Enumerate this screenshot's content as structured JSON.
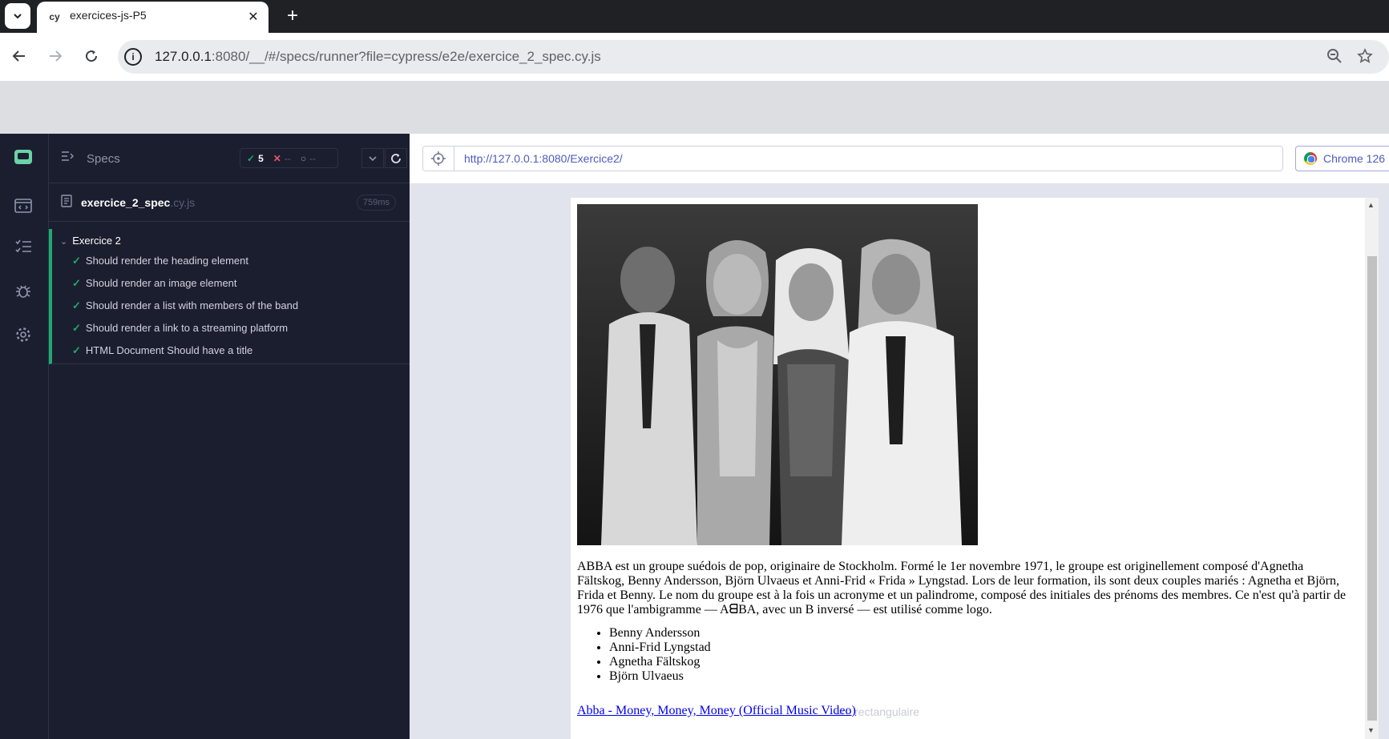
{
  "browser": {
    "tab_title": "exercices-js-P5",
    "tab_favicon_text": "cy",
    "new_tab_symbol": "+",
    "close_symbol": "✕",
    "url_host": "127.0.0.1",
    "url_rest": ":8080/__/#/specs/runner?file=cypress/e2e/exercice_2_spec.cy.js"
  },
  "runner": {
    "specs_label": "Specs",
    "stats": {
      "passed": "5",
      "failed": "--",
      "pending": "--"
    },
    "spec_file": {
      "name": "exercice_2_spec",
      "ext": ".cy.js",
      "duration": "759ms"
    },
    "suite": {
      "title": "Exercice 2",
      "tests": [
        {
          "title": "Should render the heading element"
        },
        {
          "title": "Should render an image element"
        },
        {
          "title": "Should render a list with members of the band"
        },
        {
          "title": "Should render a link to a streaming platform"
        },
        {
          "title": "HTML Document Should have a title"
        }
      ]
    }
  },
  "aut": {
    "url": "http://127.0.0.1:8080/Exercice2/",
    "browser_label": "Chrome 126",
    "paragraph": "ABBA est un groupe suédois de pop, originaire de Stockholm. Formé le 1er novembre 1971, le groupe est originellement composé d'Agnetha Fältskog, Benny Andersson, Björn Ulvaeus et Anni-Frid « Frida » Lyngstad. Lors de leur formation, ils sont deux couples mariés : Agnetha et Björn, Frida et Benny. Le nom du groupe est à la fois un acronyme et un palindrome, composé des initiales des prénoms des membres. Ce n'est qu'à partir de 1976 que l'ambigramme — AᗺBA, avec un B inversé — est utilisé comme logo.",
    "members": [
      "Benny Andersson",
      "Anni-Frid Lyngstad",
      "Agnetha Fältskog",
      "Björn Ulvaeus"
    ],
    "link_text": "Abba - Money, Money, Money (Official Music Video)",
    "ghost_text": "ure rectangulaire"
  }
}
